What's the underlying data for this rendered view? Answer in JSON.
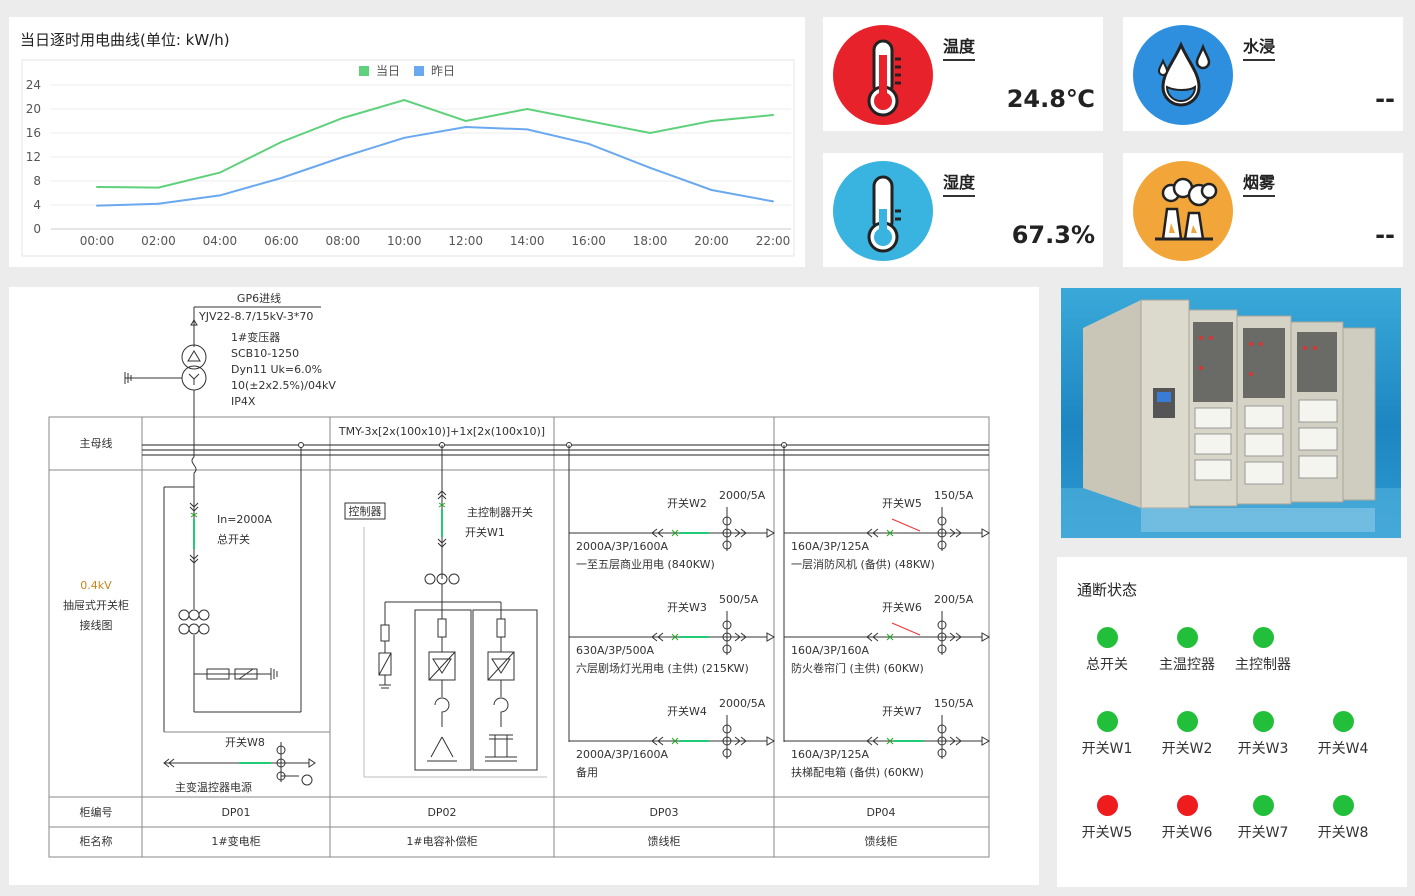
{
  "chart_panel": {
    "title": "当日逐时用电曲线(单位: kW/h)"
  },
  "chart_data": {
    "type": "line",
    "x": [
      "00:00",
      "02:00",
      "04:00",
      "06:00",
      "08:00",
      "10:00",
      "12:00",
      "14:00",
      "16:00",
      "18:00",
      "20:00",
      "22:00"
    ],
    "series": [
      {
        "name": "当日",
        "color": "#5fd17c",
        "values": [
          7,
          6.9,
          9.4,
          14.5,
          18.5,
          21.5,
          18,
          20,
          18,
          16,
          18,
          19
        ]
      },
      {
        "name": "昨日",
        "color": "#6aa9ef",
        "values": [
          3.9,
          4.2,
          5.6,
          8.5,
          12,
          15.2,
          17,
          16.6,
          14.2,
          10.2,
          6.5,
          4.6
        ]
      }
    ],
    "yticks": [
      "0",
      "4",
      "8",
      "12",
      "16",
      "20",
      "24"
    ],
    "ylim": [
      0,
      24
    ],
    "legend": "top-center",
    "grid": true
  },
  "sensors": {
    "temperature": {
      "label": "温度",
      "value": "24.8℃",
      "color": "#e8222b",
      "icon": "thermometer-icon"
    },
    "water": {
      "label": "水浸",
      "value": "--",
      "color": "#2f8fdf",
      "icon": "water-drop-icon"
    },
    "humidity": {
      "label": "湿度",
      "value": "67.3%",
      "color": "#39b3e0",
      "icon": "thermometer-icon"
    },
    "smoke": {
      "label": "烟雾",
      "value": "--",
      "color": "#f2a63a",
      "icon": "factory-smoke-icon"
    }
  },
  "diagram": {
    "incoming": "GP6进线",
    "cable": "YJV22-8.7/15kV-3*70",
    "transformer": [
      "1#变压器",
      "SCB10-1250",
      "Dyn11 Uk=6.0%",
      "10(±2x2.5%)/04kV",
      "IP4X"
    ],
    "busbar_label": "主母线",
    "busbar_spec": "TMY-3x[2x(100x10)]+1x[2x(100x10)]",
    "side_label": [
      "0.4kV",
      "抽屉式开关柜",
      "接线图"
    ],
    "dp01": {
      "in": "In=2000A",
      "main": "总开关",
      "w8": "开关W8",
      "w8_desc": "主变温控器电源"
    },
    "dp02": {
      "ctrl": "控制器",
      "sw_title": "主控制器开关",
      "sw_name": "开关W1"
    },
    "dp03": [
      {
        "sw": "开关W2",
        "ct": "2000/5A",
        "spec": "2000A/3P/1600A",
        "desc": "一至五层商业用电 (840KW)"
      },
      {
        "sw": "开关W3",
        "ct": "500/5A",
        "spec": "630A/3P/500A",
        "desc": "六层剧场灯光用电 (主供) (215KW)"
      },
      {
        "sw": "开关W4",
        "ct": "2000/5A",
        "spec": "2000A/3P/1600A",
        "desc": "备用"
      }
    ],
    "dp04": [
      {
        "sw": "开关W5",
        "ct": "150/5A",
        "spec": "160A/3P/125A",
        "desc": "一层消防风机 (备供) (48KW)"
      },
      {
        "sw": "开关W6",
        "ct": "200/5A",
        "spec": "160A/3P/160A",
        "desc": "防火卷帘门 (主供) (60KW)"
      },
      {
        "sw": "开关W7",
        "ct": "150/5A",
        "spec": "160A/3P/125A",
        "desc": "扶梯配电箱 (备供) (60KW)"
      }
    ],
    "row_label_no": "柜编号",
    "row_label_name": "柜名称",
    "cabinets": [
      {
        "no": "DP01",
        "name": "1#变电柜"
      },
      {
        "no": "DP02",
        "name": "1#电容补偿柜"
      },
      {
        "no": "DP03",
        "name": "馈线柜"
      },
      {
        "no": "DP04",
        "name": "馈线柜"
      }
    ]
  },
  "status_panel": {
    "title": "通断状态",
    "items": [
      {
        "name": "总开关",
        "color": "#22c03a"
      },
      {
        "name": "主温控器",
        "color": "#22c03a"
      },
      {
        "name": "主控制器",
        "color": "#22c03a"
      },
      {
        "name": "开关W1",
        "color": "#22c03a"
      },
      {
        "name": "开关W2",
        "color": "#22c03a"
      },
      {
        "name": "开关W3",
        "color": "#22c03a"
      },
      {
        "name": "开关W4",
        "color": "#22c03a"
      },
      {
        "name": "开关W5",
        "color": "#ee1c1c"
      },
      {
        "name": "开关W6",
        "color": "#ee1c1c"
      },
      {
        "name": "开关W7",
        "color": "#22c03a"
      },
      {
        "name": "开关W8",
        "color": "#22c03a"
      }
    ]
  }
}
